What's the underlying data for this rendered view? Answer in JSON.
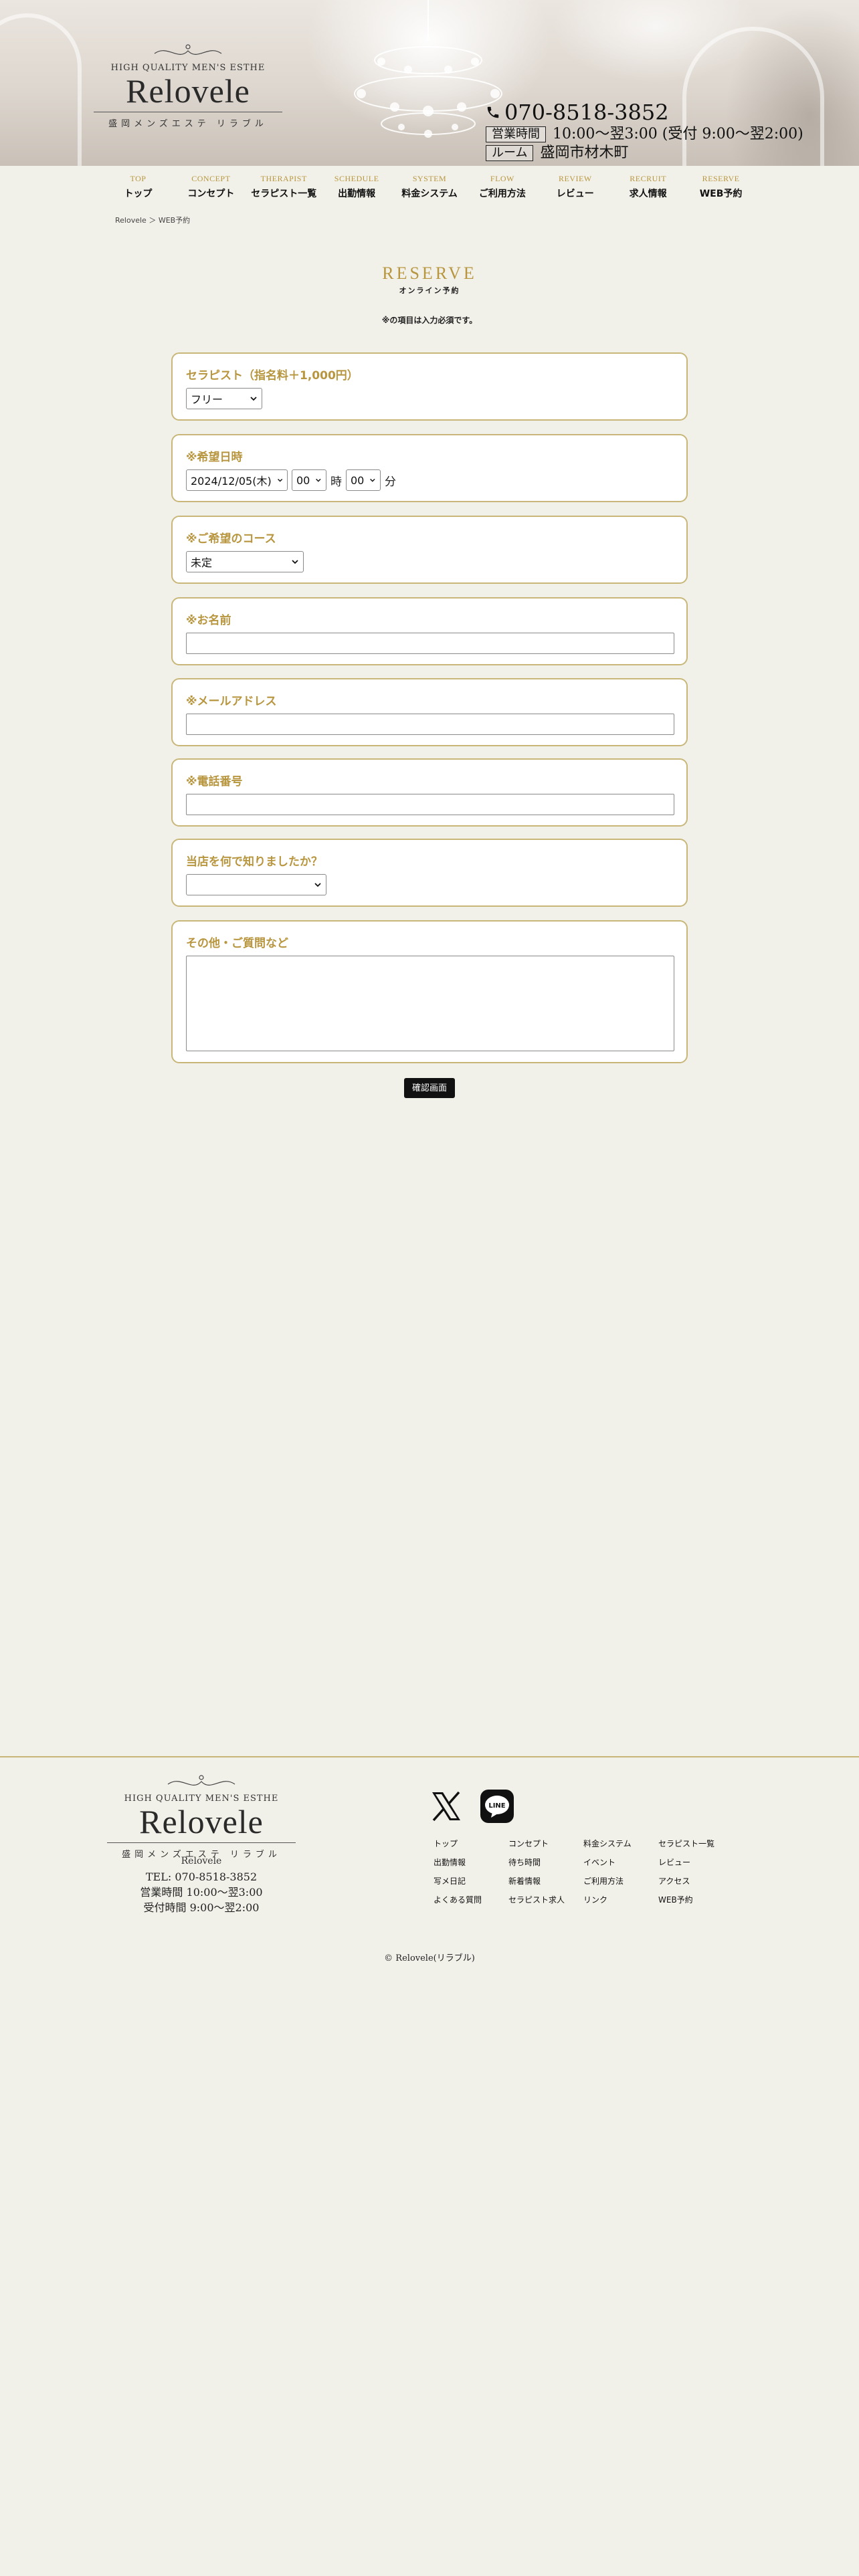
{
  "header": {
    "logo_tagline": "HIGH QUALITY MEN'S ESTHE",
    "logo_name": "Relovele",
    "logo_jp": "盛岡メンズエステ リラブル",
    "phone": "070-8518-3852",
    "hours_label": "営業時間",
    "hours_value": "10:00〜翌3:00 (受付 9:00〜翌2:00)",
    "room_label": "ルーム",
    "room_value": "盛岡市材木町"
  },
  "nav": [
    {
      "en": "TOP",
      "jp": "トップ"
    },
    {
      "en": "CONCEPT",
      "jp": "コンセプト"
    },
    {
      "en": "THERAPIST",
      "jp": "セラピスト一覧"
    },
    {
      "en": "SCHEDULE",
      "jp": "出勤情報"
    },
    {
      "en": "SYSTEM",
      "jp": "料金システム"
    },
    {
      "en": "FLOW",
      "jp": "ご利用方法"
    },
    {
      "en": "REVIEW",
      "jp": "レビュー"
    },
    {
      "en": "RECRUIT",
      "jp": "求人情報"
    },
    {
      "en": "RESERVE",
      "jp": "WEB予約"
    }
  ],
  "breadcrumb": {
    "home": "Relovele",
    "sep": "＞",
    "current": "WEB予約"
  },
  "page": {
    "title_en": "RESERVE",
    "title_jp": "オンライン予約",
    "required_note": "※の項目は入力必須です。"
  },
  "form": {
    "therapist": {
      "label": "セラピスト（指名料＋1,000円）",
      "value": "フリー"
    },
    "date": {
      "label": "※希望日時",
      "date_value": "2024/12/05(木)",
      "hour_value": "00",
      "hour_unit": "時",
      "minute_value": "00",
      "minute_unit": "分"
    },
    "course": {
      "label": "※ご希望のコース",
      "value": "未定"
    },
    "name": {
      "label": "※お名前",
      "value": ""
    },
    "email": {
      "label": "※メールアドレス",
      "value": ""
    },
    "phone": {
      "label": "※電話番号",
      "value": ""
    },
    "source": {
      "label": "当店を何で知りましたか？",
      "value": ""
    },
    "other": {
      "label": "その他・ご質問など",
      "value": ""
    },
    "confirm_label": "確認画面"
  },
  "footer": {
    "logo_tagline": "HIGH QUALITY MEN'S ESTHE",
    "logo_name": "Relovele",
    "logo_jp": "盛岡メンズエステ リラブル",
    "shop_name": "Relovele",
    "tel": "TEL: 070-8518-3852",
    "hours": "営業時間 10:00〜翌3:00",
    "reception": "受付時間 9:00〜翌2:00",
    "links": [
      "トップ",
      "コンセプト",
      "料金システム",
      "セラピスト一覧",
      "出勤情報",
      "待ち時間",
      "イベント",
      "レビュー",
      "写メ日記",
      "新着情報",
      "ご利用方法",
      "アクセス",
      "よくある質問",
      "セラピスト求人",
      "リンク",
      "WEB予約"
    ],
    "copyright": "© Relovele(リラブル)",
    "social": [
      "x-icon",
      "line-icon"
    ]
  },
  "colors": {
    "accent_gold": "#b8963f",
    "card_border": "#c9b779",
    "background": "#f2f1e9"
  }
}
